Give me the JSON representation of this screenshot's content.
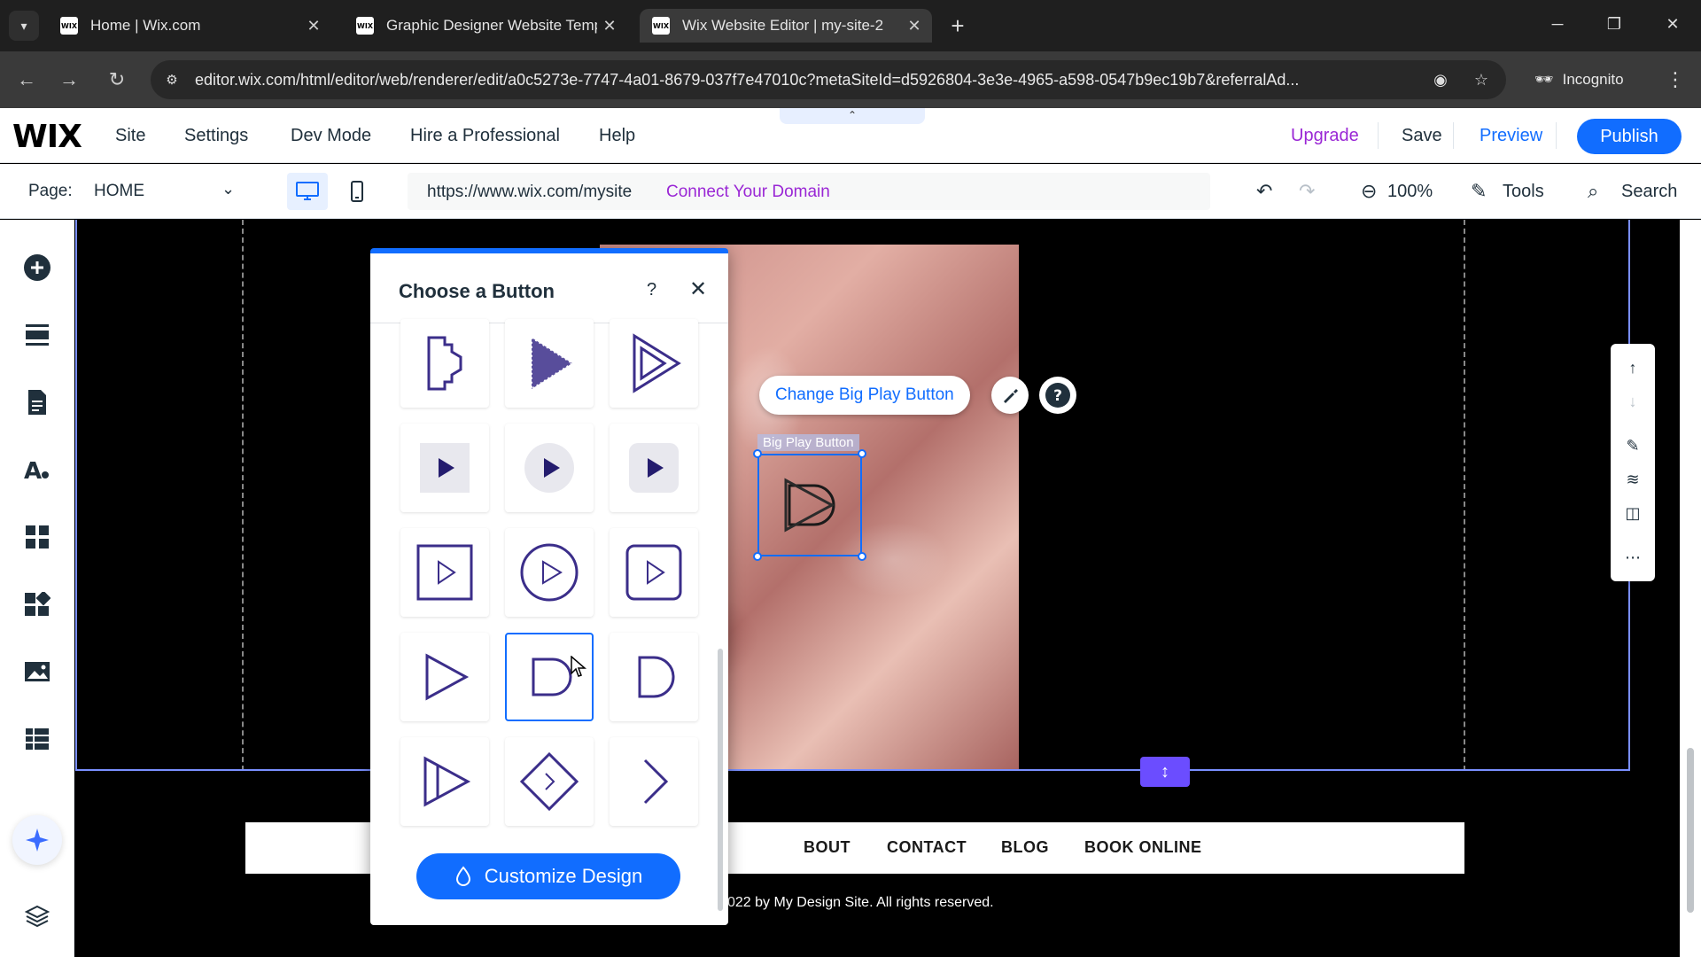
{
  "browser": {
    "tabs": [
      {
        "title": "Home | Wix.com",
        "active": false
      },
      {
        "title": "Graphic Designer Website Temp",
        "active": false
      },
      {
        "title": "Wix Website Editor | my-site-2",
        "active": true
      }
    ],
    "favicon_text": "WIX",
    "url": "editor.wix.com/html/editor/web/renderer/edit/a0c5273e-7747-4a01-8679-037f7e47010c?metaSiteId=d5926804-3e3e-4965-a598-0547b9ec19b7&referralAd...",
    "incognito_label": "Incognito"
  },
  "wix": {
    "logo": "WIX",
    "menu": [
      "Site",
      "Settings",
      "Dev Mode",
      "Hire a Professional",
      "Help"
    ],
    "upgrade": "Upgrade",
    "save": "Save",
    "preview": "Preview",
    "publish": "Publish"
  },
  "toolbar": {
    "page_label": "Page:",
    "page_name": "HOME",
    "site_url": "https://www.wix.com/mysite",
    "connect_domain": "Connect Your Domain",
    "zoom": "100%",
    "tools": "Tools",
    "search": "Search"
  },
  "canvas": {
    "change_button": "Change Big Play Button",
    "element_label": "Big Play Button",
    "footer_menu": [
      "BOUT",
      "CONTACT",
      "BLOG",
      "BOOK ONLINE"
    ],
    "copyright": "022 by My Design Site. All rights reserved."
  },
  "panel": {
    "title": "Choose a Button",
    "help": "?",
    "customize": "Customize Design",
    "selected_index": 10
  },
  "colors": {
    "accent": "#116dff",
    "upgrade": "#9a27d5",
    "icon_dark": "#3b2e8a"
  }
}
